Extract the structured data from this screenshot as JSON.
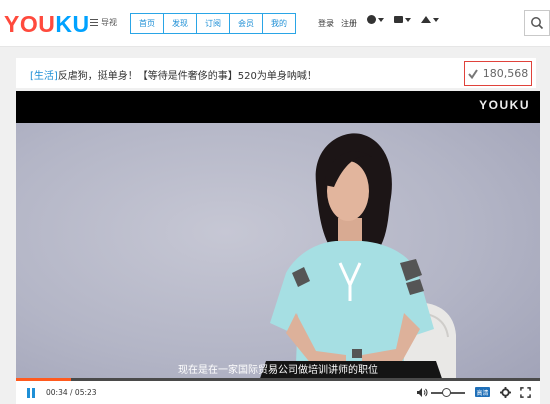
{
  "header": {
    "logo": {
      "part1": "YO",
      "part2": "U",
      "part3": "KU"
    },
    "guide_label": "导视",
    "nav": [
      "首页",
      "发现",
      "订阅",
      "会员",
      "我的"
    ],
    "auth": [
      "登录",
      "注册"
    ],
    "tools": [
      "history-icon",
      "mail-icon",
      "upload-icon"
    ]
  },
  "video": {
    "category": "[生活]",
    "title": "反虐狗，挺单身！【等待是件奢侈的事】520为单身呐喊！",
    "view_count": "180,568",
    "watermark": "YOUKU",
    "subtitle": "现在是在一家国际贸易公司做培训讲师的职位",
    "current_time": "00:34",
    "duration": "05:23",
    "progress": 0.105,
    "quality": "高清",
    "volume": 0.45
  },
  "colors": {
    "accent": "#1e8fd6",
    "brand_red": "#ff4a3d",
    "progress": "#ff5a1e",
    "counter_border": "#e0423b"
  }
}
